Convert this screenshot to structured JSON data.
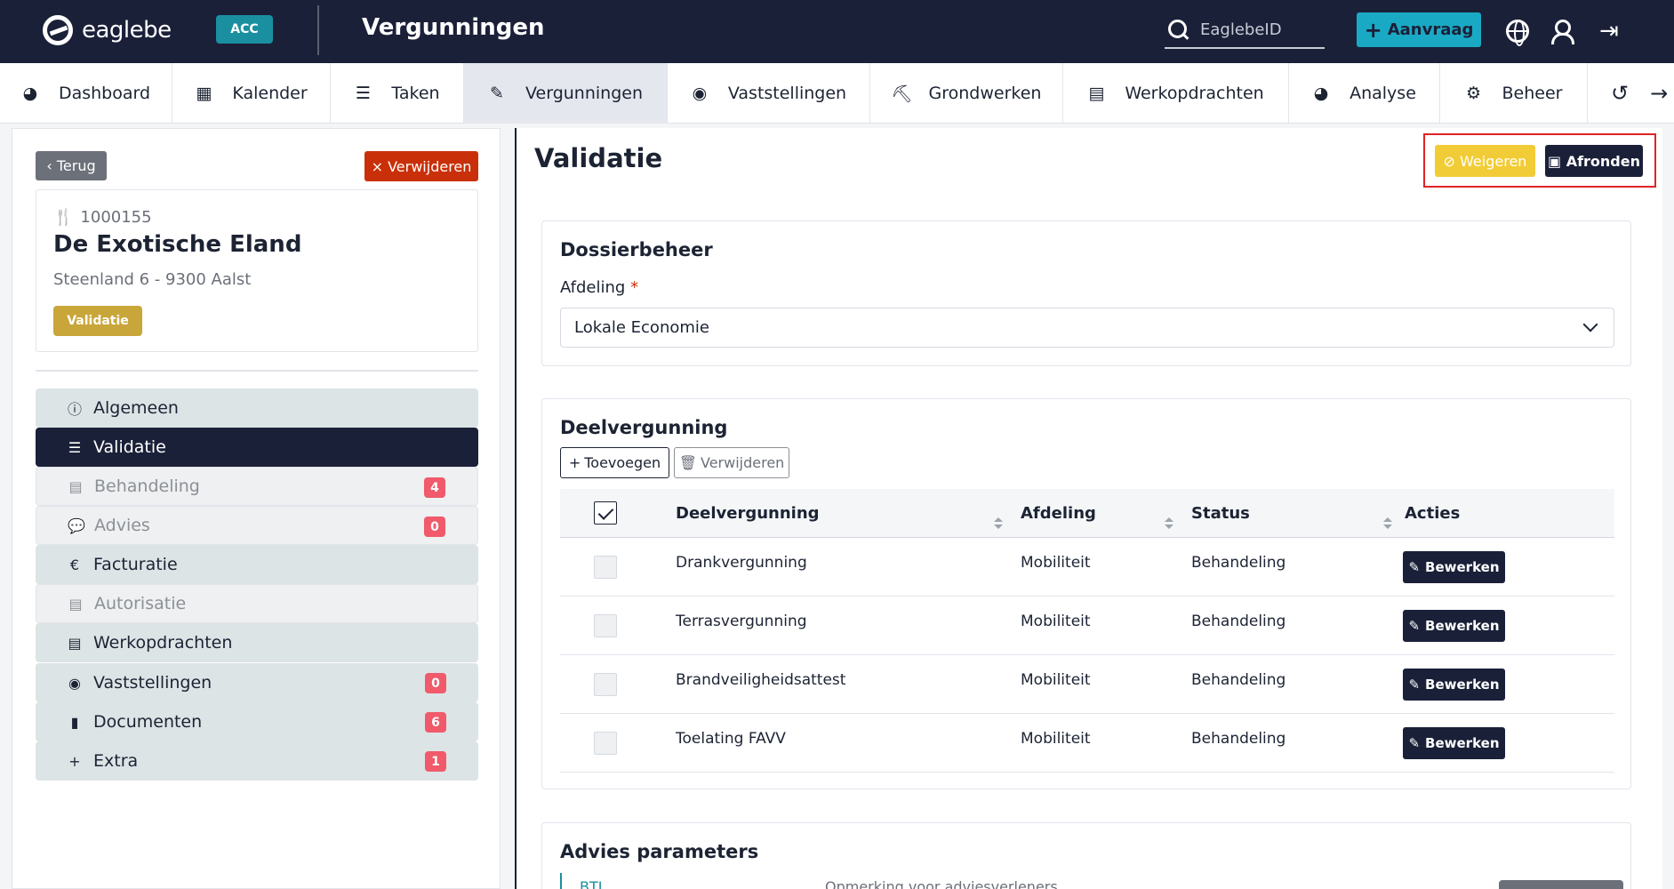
{
  "app": {
    "logo_text": "eaglebe",
    "env_badge": "ACC",
    "page_title": "Vergunningen",
    "search_placeholder": "EaglebeID",
    "aanvraag_label": "Aanvraag"
  },
  "nav": {
    "items": [
      {
        "label": "Dashboard",
        "icon": "dashboard-icon"
      },
      {
        "label": "Kalender",
        "icon": "calendar-icon"
      },
      {
        "label": "Taken",
        "icon": "tasks-icon"
      },
      {
        "label": "Vergunningen",
        "icon": "permit-icon",
        "active": true
      },
      {
        "label": "Vaststellingen",
        "icon": "eye-icon"
      },
      {
        "label": "Grondwerken",
        "icon": "digging-icon"
      },
      {
        "label": "Werkopdrachten",
        "icon": "document-icon"
      },
      {
        "label": "Analyse",
        "icon": "analysis-icon"
      },
      {
        "label": "Beheer",
        "icon": "gears-icon"
      }
    ]
  },
  "left": {
    "back_label": "Terug",
    "delete_label": "Verwijderen",
    "dossier": {
      "id": "1000155",
      "name": "De Exotische Eland",
      "address": "Steenland 6 - 9300 Aalst",
      "status": "Validatie"
    },
    "menu": [
      {
        "label": "Algemeen",
        "icon": "info-icon",
        "state": "normal",
        "badge": null
      },
      {
        "label": "Validatie",
        "icon": "checklist-icon",
        "state": "active",
        "badge": null
      },
      {
        "label": "Behandeling",
        "icon": "file-icon",
        "state": "disabled",
        "badge": "4"
      },
      {
        "label": "Advies",
        "icon": "comment-icon",
        "state": "disabled",
        "badge": "0"
      },
      {
        "label": "Facturatie",
        "icon": "euro-icon",
        "state": "normal",
        "badge": null
      },
      {
        "label": "Autorisatie",
        "icon": "file-lock-icon",
        "state": "disabled",
        "badge": null
      },
      {
        "label": "Werkopdrachten",
        "icon": "document-icon",
        "state": "normal",
        "badge": null
      },
      {
        "label": "Vaststellingen",
        "icon": "eye-icon",
        "state": "normal",
        "badge": "0"
      },
      {
        "label": "Documenten",
        "icon": "file-icon",
        "state": "normal",
        "badge": "6"
      },
      {
        "label": "Extra",
        "icon": "plus-icon",
        "state": "normal",
        "badge": "1"
      }
    ]
  },
  "main": {
    "title": "Validatie",
    "weigeren_label": "Weigeren",
    "afronden_label": "Afronden",
    "dossierbeheer": {
      "title": "Dossierbeheer",
      "afdeling_label": "Afdeling",
      "required_mark": "*",
      "afdeling_value": "Lokale Economie"
    },
    "deelvergunning": {
      "title": "Deelvergunning",
      "add_label": "Toevoegen",
      "delete_label": "Verwijderen",
      "columns": [
        "Deelvergunning",
        "Afdeling",
        "Status",
        "Acties"
      ],
      "rows": [
        {
          "name": "Drankvergunning",
          "afdeling": "Mobiliteit",
          "status": "Behandeling"
        },
        {
          "name": "Terrasvergunning",
          "afdeling": "Mobiliteit",
          "status": "Behandeling"
        },
        {
          "name": "Brandveiligheidsattest",
          "afdeling": "Mobiliteit",
          "status": "Behandeling"
        },
        {
          "name": "Toelating FAVV",
          "afdeling": "Mobiliteit",
          "status": "Behandeling"
        }
      ],
      "edit_label": "Bewerken"
    },
    "advies": {
      "title": "Advies parameters",
      "col_a": "BTL",
      "col_b": "Opmerking voor adviesverleners"
    }
  }
}
